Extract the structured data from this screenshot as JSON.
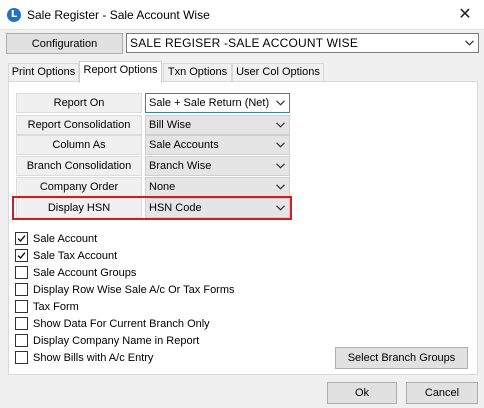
{
  "window": {
    "title": "Sale Register - Sale Account Wise",
    "app_icon_glyph": "L"
  },
  "configuration": {
    "button_label": "Configuration",
    "selected": "SALE REGISER -SALE ACCOUNT WISE"
  },
  "tabs": [
    {
      "label": "Print Options",
      "active": false
    },
    {
      "label": "Report Options",
      "active": true
    },
    {
      "label": "Txn Options",
      "active": false
    },
    {
      "label": "User Col Options",
      "active": false
    }
  ],
  "report_options": [
    {
      "label": "Report On",
      "value": "Sale + Sale Return (Net)"
    },
    {
      "label": "Report Consolidation",
      "value": "Bill Wise"
    },
    {
      "label": "Column As",
      "value": "Sale Accounts"
    },
    {
      "label": "Branch Consolidation",
      "value": "Branch Wise"
    },
    {
      "label": "Company Order",
      "value": "None"
    },
    {
      "label": "Display HSN",
      "value": "HSN Code"
    }
  ],
  "checkboxes": [
    {
      "label": "Sale Account",
      "checked": true
    },
    {
      "label": "Sale Tax Account",
      "checked": true
    },
    {
      "label": "Sale Account Groups",
      "checked": false
    },
    {
      "label": "Display Row Wise Sale A/c Or Tax Forms",
      "checked": false
    },
    {
      "label": "Tax Form",
      "checked": false
    },
    {
      "label": "Show Data For Current Branch Only",
      "checked": false
    },
    {
      "label": "Display Company Name in Report",
      "checked": false
    },
    {
      "label": "Show Bills with A/c Entry",
      "checked": false
    }
  ],
  "buttons": {
    "select_branch_groups": "Select Branch Groups",
    "ok": "Ok",
    "cancel": "Cancel"
  },
  "colors": {
    "highlight": "#d11d1d",
    "app_icon": "#1e73c8",
    "focus_border": "#3c7fb1"
  },
  "icons": {
    "close": "close-icon",
    "dropdown": "chevron-down-icon",
    "check": "check-icon"
  }
}
